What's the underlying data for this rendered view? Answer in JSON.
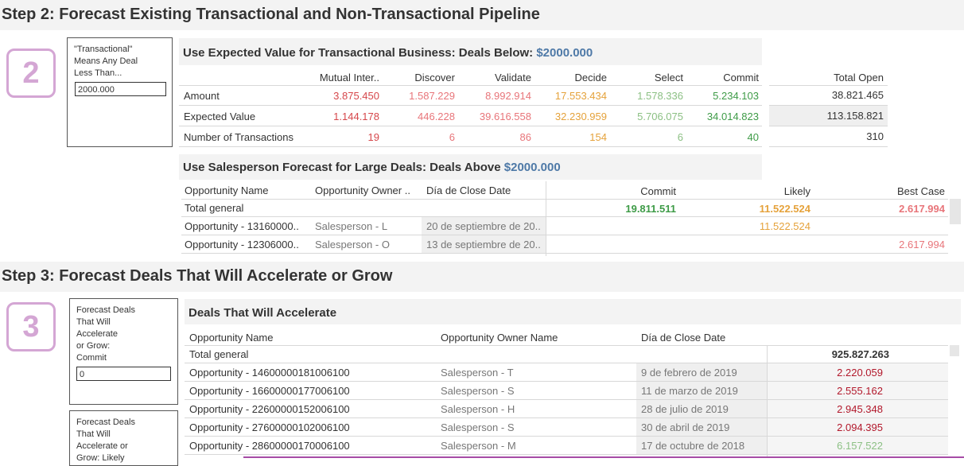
{
  "colors": {
    "red": "#d6474b",
    "pink_red": "#e8757a",
    "orange": "#e5a23b",
    "light_green": "#8cc084",
    "green": "#3e9b47",
    "dark_red": "#b2182b",
    "accent_blue": "#4e79a7",
    "badge_pink": "#d4a6d4"
  },
  "step2": {
    "title": "Step 2: Forecast Existing Transactional and Non-Transactional Pipeline",
    "badge": "2",
    "control": {
      "label": "\"Transactional\"\nMeans Any Deal\nLess Than...",
      "value": "2000.000"
    },
    "expected_panel": {
      "title_prefix": "Use Expected Value for Transactional Business: Deals Below: ",
      "title_value": "$2000.000",
      "columns": [
        "Mutual Inter..",
        "Discover",
        "Validate",
        "Decide",
        "Select",
        "Commit"
      ],
      "total_header": "Total Open",
      "rows": [
        {
          "label": "Amount",
          "values": [
            "3.875.450",
            "1.587.229",
            "8.992.914",
            "17.553.434",
            "1.578.336",
            "5.234.103"
          ],
          "total": "38.821.465"
        },
        {
          "label": "Expected Value",
          "values": [
            "1.144.178",
            "446.228",
            "39.616.558",
            "32.230.959",
            "5.706.075",
            "34.014.823"
          ],
          "total": "113.158.821"
        },
        {
          "label": "Number of Transactions",
          "values": [
            "19",
            "6",
            "86",
            "154",
            "6",
            "40"
          ],
          "total": "310"
        }
      ]
    },
    "large_panel": {
      "title_prefix": "Use Salesperson Forecast for Large Deals: Deals Above ",
      "title_value": "$2000.000",
      "headers": {
        "name": "Opportunity Name",
        "owner": "Opportunity Owner ..",
        "date": "Día de Close Date",
        "commit": "Commit",
        "likely": "Likely",
        "best": "Best Case"
      },
      "total_label": "Total general",
      "total": {
        "commit": "19.811.511",
        "likely": "11.522.524",
        "best": "2.617.994"
      },
      "rows": [
        {
          "name": "Opportunity - 13160000..",
          "owner": "Salesperson - L",
          "date": "20 de septiembre de 20..",
          "commit": "",
          "likely": "11.522.524",
          "best": ""
        },
        {
          "name": "Opportunity - 12306000..",
          "owner": "Salesperson - O",
          "date": "13 de septiembre de 20..",
          "commit": "",
          "likely": "",
          "best": "2.617.994"
        }
      ]
    }
  },
  "step3": {
    "title": "Step 3: Forecast Deals That Will Accelerate or Grow",
    "badge": "3",
    "control1": {
      "label": "Forecast Deals\nThat Will\nAccelerate\nor Grow:\nCommit",
      "value": "0"
    },
    "control2": {
      "label": "Forecast Deals\nThat Will\nAccelerate or\nGrow: Likely"
    },
    "accelerate_panel": {
      "title": "Deals That Will Accelerate",
      "headers": {
        "name": "Opportunity Name",
        "owner": "Opportunity Owner Name",
        "date": "Día de Close Date"
      },
      "total_label": "Total general",
      "total_value": "925.827.263",
      "rows": [
        {
          "name": "Opportunity - 14600000181006100",
          "owner": "Salesperson - T",
          "date": "9 de febrero de 2019",
          "value": "2.220.059"
        },
        {
          "name": "Opportunity - 16600000177006100",
          "owner": "Salesperson - S",
          "date": "11 de marzo de 2019",
          "value": "2.555.162"
        },
        {
          "name": "Opportunity - 22600000152006100",
          "owner": "Salesperson - H",
          "date": "28 de julio de 2019",
          "value": "2.945.348"
        },
        {
          "name": "Opportunity - 27600000102006100",
          "owner": "Salesperson - S",
          "date": "30 de abril de 2019",
          "value": "2.094.395"
        },
        {
          "name": "Opportunity - 28600000170006100",
          "owner": "Salesperson - M",
          "date": "17 de octubre de 2018",
          "value": "6.157.522"
        }
      ]
    }
  }
}
